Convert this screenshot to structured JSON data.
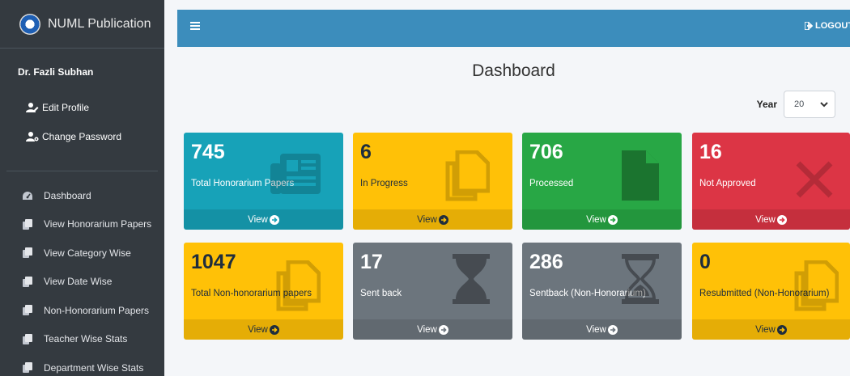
{
  "brand": {
    "title": "NUML Publication"
  },
  "user": {
    "name": "Dr. Fazli Subhan",
    "links": [
      {
        "label": "Edit Profile",
        "icon": "user-edit-icon"
      },
      {
        "label": "Change Password",
        "icon": "user-cog-icon"
      }
    ]
  },
  "nav": [
    {
      "label": "Dashboard",
      "icon": "tachometer-icon"
    },
    {
      "label": "View Honorarium Papers",
      "icon": "copy-icon"
    },
    {
      "label": "View Category Wise",
      "icon": "copy-icon"
    },
    {
      "label": "View Date Wise",
      "icon": "copy-icon"
    },
    {
      "label": "Non-Honorarium Papers",
      "icon": "copy-icon"
    },
    {
      "label": "Teacher Wise Stats",
      "icon": "copy-icon"
    },
    {
      "label": "Department Wise Stats",
      "icon": "copy-icon"
    }
  ],
  "header": {
    "logout_label": "LOGOUT"
  },
  "main": {
    "title": "Dashboard",
    "year_label": "Year",
    "year_value": "20"
  },
  "cards": [
    {
      "value": "745",
      "caption": "Total Honorarium Papers",
      "link": "View",
      "color": "#17a2b8",
      "icon": "newspaper-icon"
    },
    {
      "value": "6",
      "caption": "In Progress",
      "link": "View",
      "color": "#ffc107",
      "icon": "copy-icon"
    },
    {
      "value": "706",
      "caption": "Processed",
      "link": "View",
      "color": "#28a745",
      "icon": "file-icon"
    },
    {
      "value": "16",
      "caption": "Not Approved",
      "link": "View",
      "color": "#dc3545",
      "icon": "times-icon"
    },
    {
      "value": "1047",
      "caption": "Total Non-honorarium papers",
      "link": "View",
      "color": "#ffc107",
      "icon": "copy-icon"
    },
    {
      "value": "17",
      "caption": "Sent back",
      "link": "View",
      "color": "#6c757d",
      "icon": "hourglass-icon"
    },
    {
      "value": "286",
      "caption": "Sentback (Non-Honorarium)",
      "link": "View",
      "color": "#6c757d",
      "icon": "hourglass-outline-icon"
    },
    {
      "value": "0",
      "caption": "Resubmitted (Non-Honorarium)",
      "link": "View",
      "color": "#ffc107",
      "icon": "copy-icon"
    }
  ]
}
